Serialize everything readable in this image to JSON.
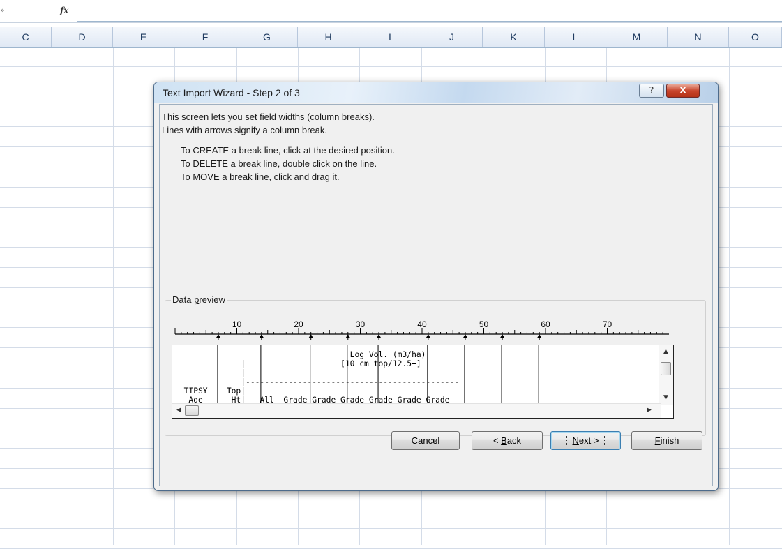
{
  "formula_bar": {
    "fx_label": "fx",
    "cell_edge": "»"
  },
  "columns": [
    "C",
    "D",
    "E",
    "F",
    "G",
    "H",
    "I",
    "J",
    "K",
    "L",
    "M",
    "N",
    "O"
  ],
  "dialog": {
    "title": "Text Import Wizard - Step 2 of 3",
    "help_button": "?",
    "close_button": "X",
    "intro_line1": "This screen lets you set field widths (column breaks).",
    "intro_line2": "Lines with arrows signify a column break.",
    "instr_create": "To CREATE a break line, click at the desired position.",
    "instr_delete": "To DELETE a break line, double click on the line.",
    "instr_move": "To MOVE a break line, click and drag it.",
    "preview": {
      "legend_prefix": "Data ",
      "legend_underlined": "p",
      "legend_suffix": "review",
      "ruler_labels": [
        "10",
        "20",
        "30",
        "40",
        "50",
        "60",
        "70"
      ],
      "column_breaks": [
        7,
        14,
        22,
        28,
        33,
        41,
        47,
        53,
        59
      ],
      "lines": [
        "                                     Log Vol. (m3/ha)",
        "              |                    [10 cm top/12.5+]",
        "              |",
        "              |---------------------------------------------",
        "  TIPSY    Top|",
        "   Age      Ht|   All  Grade Grade Grade Grade Grade Grade"
      ]
    },
    "buttons": {
      "cancel": "Cancel",
      "back_prefix": "< ",
      "back_underlined": "B",
      "back_suffix": "ack",
      "next_underlined": "N",
      "next_suffix": "ext >",
      "finish_underlined": "F",
      "finish_suffix": "inish"
    }
  }
}
